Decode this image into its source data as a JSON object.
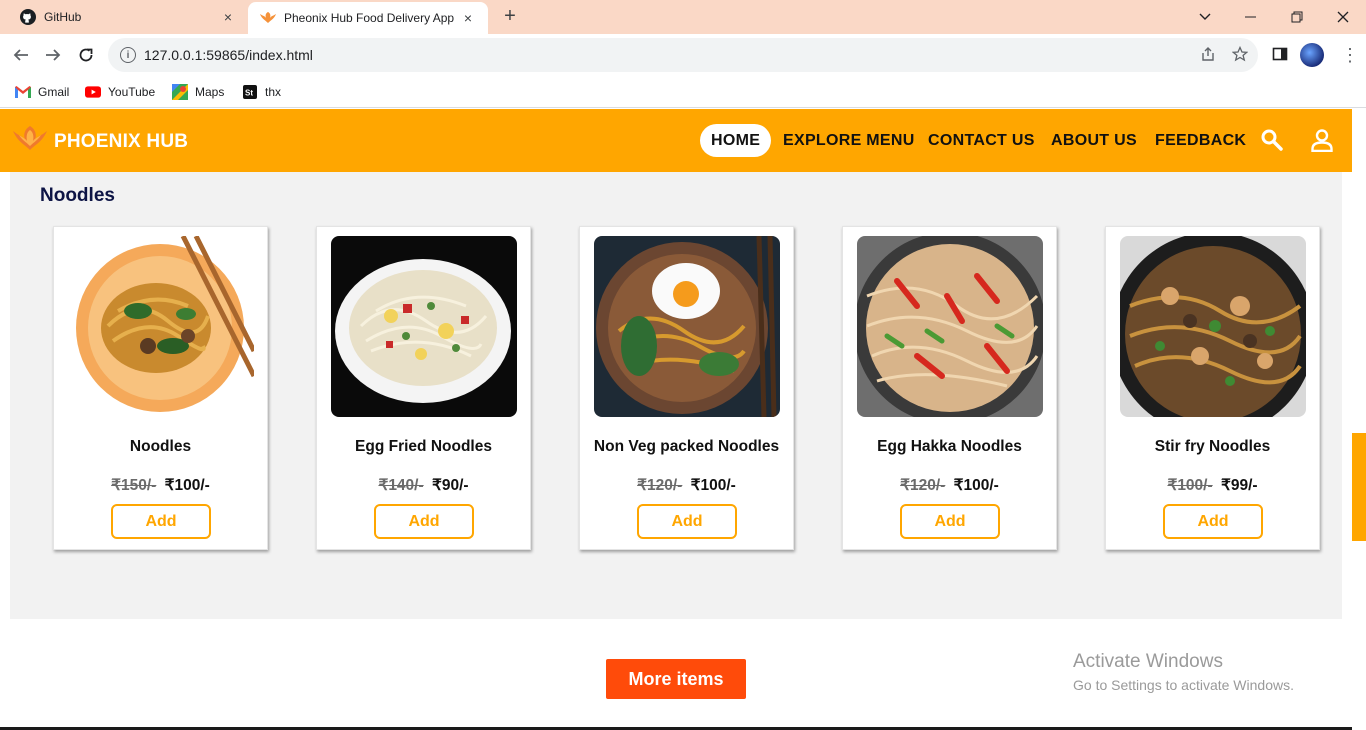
{
  "browser": {
    "tabs": [
      {
        "title": "GitHub",
        "close": "×"
      },
      {
        "title": "Pheonix Hub Food Delivery App",
        "close": "×"
      }
    ],
    "new_tab": "+",
    "url": "127.0.0.1:59865/index.html",
    "bookmarks": [
      {
        "label": "Gmail"
      },
      {
        "label": "YouTube"
      },
      {
        "label": "Maps"
      },
      {
        "label": "thx"
      }
    ]
  },
  "site": {
    "brand": "PHOENIX HUB",
    "nav": [
      "HOME",
      "EXPLORE MENU",
      "CONTACT US",
      "ABOUT US",
      "FEEDBACK"
    ],
    "active_nav": "HOME",
    "accent_color": "#ffa600",
    "cta_color": "#ff4b0a"
  },
  "section": {
    "title": "Noodles",
    "items": [
      {
        "name": "Noodles",
        "old_price": "₹150/-",
        "price": "₹100/-",
        "button": "Add"
      },
      {
        "name": "Egg Fried Noodles",
        "old_price": "₹140/-",
        "price": "₹90/-",
        "button": "Add"
      },
      {
        "name": "Non Veg packed Noodles",
        "old_price": "₹120/-",
        "price": "₹100/-",
        "button": "Add"
      },
      {
        "name": "Egg Hakka Noodles",
        "old_price": "₹120/-",
        "price": "₹100/-",
        "button": "Add"
      },
      {
        "name": "Stir fry Noodles",
        "old_price": "₹100/-",
        "price": "₹99/-",
        "button": "Add"
      }
    ]
  },
  "more_button": "More items",
  "watermark": {
    "line1": "Activate Windows",
    "line2": "Go to Settings to activate Windows."
  }
}
